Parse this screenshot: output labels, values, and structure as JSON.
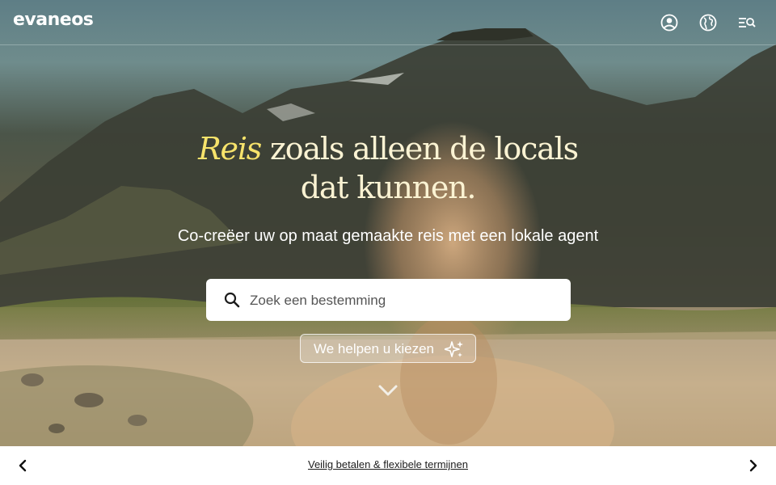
{
  "header": {
    "logo": "evaneos",
    "icons": [
      "account-icon",
      "globe-icon",
      "search-menu-icon"
    ]
  },
  "hero": {
    "headline_accent": "Reis",
    "headline_line1_rest": " zoals alleen de locals",
    "headline_line2": "dat kunnen.",
    "subtitle": "Co-creëer uw op maat gemaakte reis met een lokale agent",
    "search": {
      "placeholder": "Zoek een bestemming",
      "value": ""
    },
    "help_button": "We helpen u kiezen"
  },
  "bottom_bar": {
    "promo": "Veilig betalen & flexibele termijnen"
  },
  "colors": {
    "accent_yellow": "#f7e36b",
    "headline_cream": "#fbf3d3",
    "white": "#ffffff"
  }
}
